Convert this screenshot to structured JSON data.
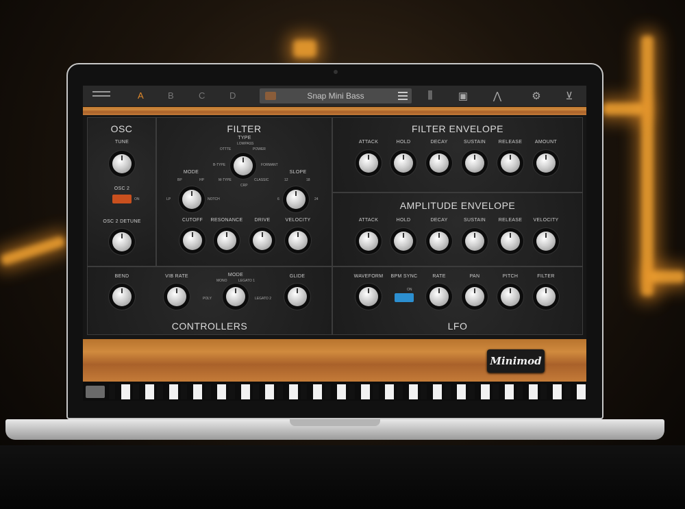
{
  "topbar": {
    "slots": [
      "A",
      "B",
      "C",
      "D"
    ],
    "active_slot": "A",
    "preset_name": "Snap Mini Bass",
    "tools": [
      "mixer-icon",
      "device-icon",
      "envelope-icon",
      "gear-icon",
      "cart-icon"
    ]
  },
  "osc": {
    "title": "OSC",
    "tune": "TUNE",
    "osc2": "OSC 2",
    "osc2_on": "ON",
    "detune": "OSC 2 DETUNE"
  },
  "filter": {
    "title": "FILTER",
    "type": "TYPE",
    "type_options": [
      "LOWPASS",
      "OTTTE",
      "POWER",
      "B-TYPE",
      "FORMANT",
      "M-TYPE",
      "CRP",
      "CLASSIC"
    ],
    "mode": "MODE",
    "mode_options": [
      "BP",
      "HP",
      "LP",
      "NOTCH"
    ],
    "slope": "SLOPE",
    "slope_options": [
      "12",
      "18",
      "6",
      "24"
    ],
    "cutoff": "CUTOFF",
    "resonance": "RESONANCE",
    "drive": "DRIVE",
    "velocity": "VELOCITY"
  },
  "filter_env": {
    "title": "FILTER ENVELOPE",
    "labels": [
      "ATTACK",
      "HOLD",
      "DECAY",
      "SUSTAIN",
      "RELEASE",
      "AMOUNT"
    ]
  },
  "amp_env": {
    "title": "AMPLITUDE ENVELOPE",
    "labels": [
      "ATTACK",
      "HOLD",
      "DECAY",
      "SUSTAIN",
      "RELEASE",
      "VELOCITY"
    ]
  },
  "controllers": {
    "title": "CONTROLLERS",
    "bend": "BEND",
    "vib_rate": "VIB RATE",
    "mode": "MODE",
    "mode_options": [
      "MONO",
      "LEGATO 1",
      "POLY",
      "LEGATO 2"
    ],
    "glide": "GLIDE"
  },
  "lfo": {
    "title": "LFO",
    "waveform": "WAVEFORM",
    "bpm_sync": "BPM SYNC",
    "bpm_on": "ON",
    "rate": "RATE",
    "pan": "PAN",
    "pitch": "PITCH",
    "filter": "FILTER"
  },
  "logo": "Minimod",
  "colors": {
    "accent": "#e0892b",
    "osc2_switch": "#c9501e",
    "bpm_switch": "#2c8fd0"
  }
}
